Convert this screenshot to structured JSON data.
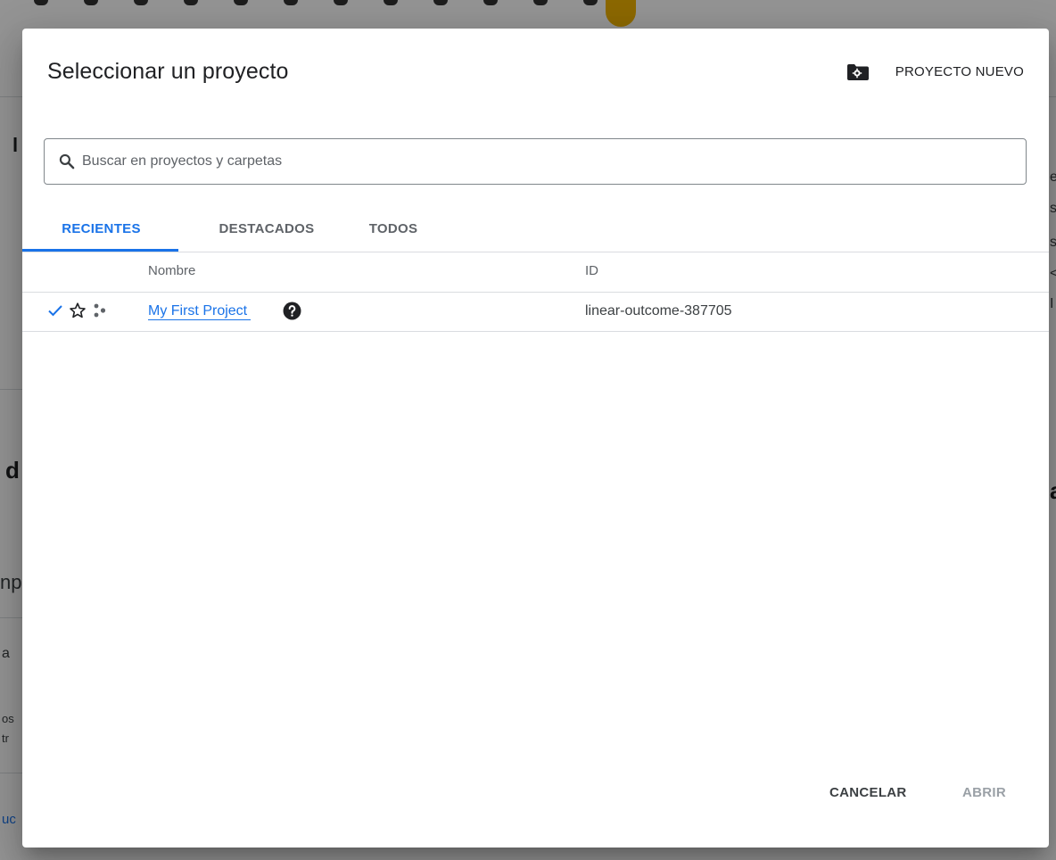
{
  "background": {
    "fragments": [
      "l",
      "d",
      "np",
      "a",
      "os",
      "tr",
      "uc",
      "e",
      "s",
      "s",
      "<",
      "I",
      "a"
    ]
  },
  "dialog": {
    "title": "Seleccionar un proyecto",
    "new_project": {
      "label": "PROYECTO NUEVO",
      "icon": "folder-settings-icon"
    },
    "search": {
      "placeholder": "Buscar en proyectos y carpetas",
      "value": "",
      "icon": "search-icon"
    },
    "tabs": [
      {
        "label": "RECIENTES",
        "active": true
      },
      {
        "label": "DESTACADOS",
        "active": false
      },
      {
        "label": "TODOS",
        "active": false
      }
    ],
    "table": {
      "headers": {
        "name": "Nombre",
        "id": "ID"
      },
      "rows": [
        {
          "selected": true,
          "name": "My First Project",
          "id": "linear-outcome-387705",
          "icons": [
            "check-icon",
            "star-outline-icon",
            "project-dots-icon",
            "help-icon"
          ]
        }
      ]
    },
    "actions": {
      "cancel": "CANCELAR",
      "open": "ABRIR"
    },
    "colors": {
      "accent": "#1a73e8",
      "text": "#202124",
      "muted": "#5f6368",
      "disabled": "#9aa0a6"
    }
  }
}
